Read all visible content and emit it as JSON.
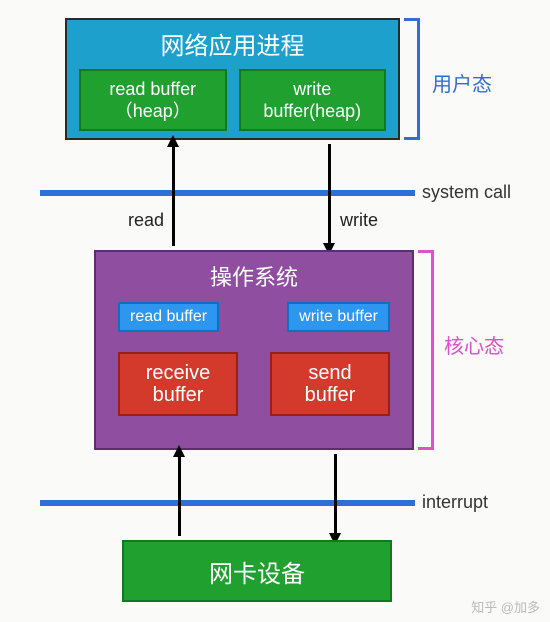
{
  "app": {
    "title": "网络应用进程",
    "read_buf": "read buffer（heap）",
    "write_buf": "write buffer(heap)"
  },
  "os": {
    "title": "操作系统",
    "read_buf": "read buffer",
    "write_buf": "write buffer",
    "recv_buf": "receive buffer",
    "send_buf": "send buffer"
  },
  "nic": {
    "title": "网卡设备"
  },
  "labels": {
    "user_mode": "用户态",
    "kernel_mode": "核心态",
    "syscall": "system call",
    "interrupt": "interrupt",
    "read": "read",
    "write": "write"
  },
  "watermark": "知乎 @加多"
}
